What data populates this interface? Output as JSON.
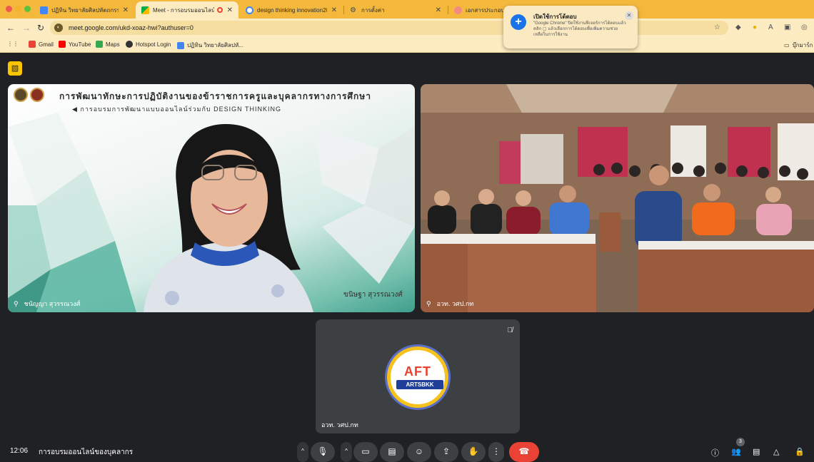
{
  "tabs": [
    {
      "title": "ปฏิทิน วิทยาลัยศิลปหัตถกรรมกรุ"
    },
    {
      "title": "Meet - การอบรมออนไลน์ของ"
    },
    {
      "title": "design thinking innovation20"
    },
    {
      "title": "การตั้งค่า"
    },
    {
      "title": "เอกสารประกอบการ"
    }
  ],
  "address": {
    "url": "meet.google.com/ukd-xoaz-hwi?authuser=0"
  },
  "bookmarks": [
    {
      "label": "Gmail"
    },
    {
      "label": "YouTube"
    },
    {
      "label": "Maps"
    },
    {
      "label": "Hotspot Login"
    },
    {
      "label": "ปฏิทิน วิทยาลัยศิลปหั..."
    }
  ],
  "bookmarks_right": "บุ๊กมาร์ก",
  "popup": {
    "title": "เปิดใช้การโต้ตอบ",
    "body": "\"Google Chrome\" ปิดใช้งานฟีเจอร์การโต้ตอบแล้ว คลิก ▢ แล้วเลือกการโต้ตอบเพื่อเพิ่มความช่วยเหลือในการใช้งาน"
  },
  "presenter": {
    "banner_line1": "การพัฒนาทักษะการปฏิบัติงานของข้าราชการครูและบุคลากรทางการศึกษา",
    "banner_line2": "◀ การอบรมการพัฒนาแบบออนไลน์ร่วมกับ DESIGN THINKING",
    "mirror_name": "ขนิษฐา สุวรรณวงศ์",
    "label": "ชนัญญา สุวรรณวงศ์"
  },
  "classroom": {
    "label": "อวท. วศป.กท"
  },
  "aft": {
    "logo_word": "AFT",
    "logo_sub": "ARTSBKK",
    "label": "อวท. วศป.กท"
  },
  "meeting": {
    "time": "12:06",
    "title": "การอบรมออนไลน์ของบุคลากร"
  },
  "people_count": "3",
  "colors": {
    "tab_strip": "#f4b83d",
    "toolbar": "#fdebc1",
    "meet_bg": "#202124",
    "end_call": "#ea4335",
    "notes": "#f9c400"
  }
}
